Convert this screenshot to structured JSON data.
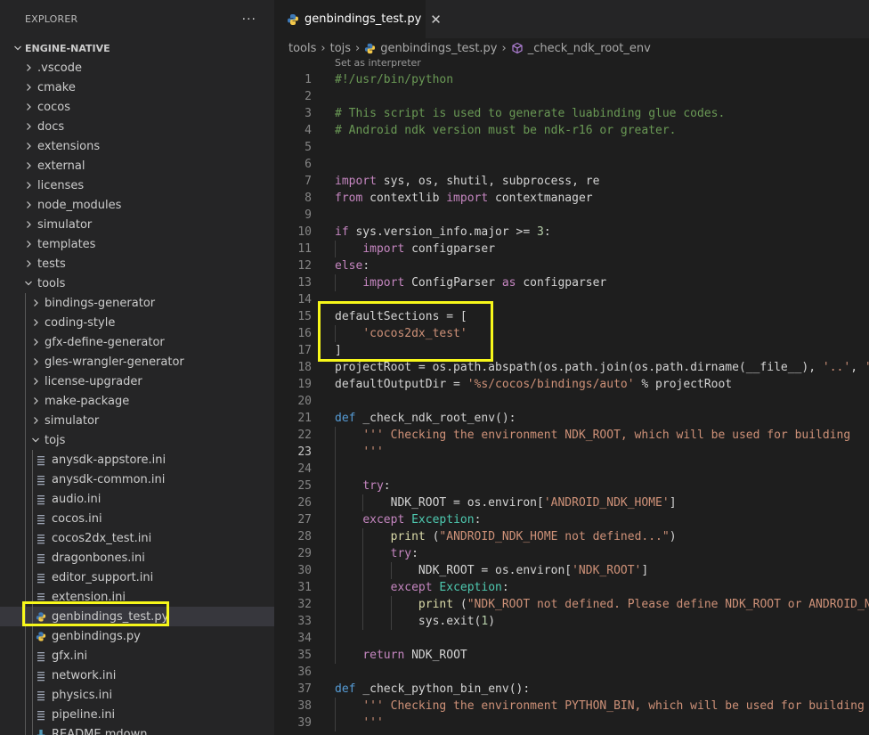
{
  "explorer": {
    "title": "EXPLORER",
    "more": "···",
    "root": "ENGINE-NATIVE",
    "items": [
      {
        "label": ".vscode",
        "type": "folder",
        "depth": 1
      },
      {
        "label": "cmake",
        "type": "folder",
        "depth": 1
      },
      {
        "label": "cocos",
        "type": "folder",
        "depth": 1
      },
      {
        "label": "docs",
        "type": "folder",
        "depth": 1
      },
      {
        "label": "extensions",
        "type": "folder",
        "depth": 1
      },
      {
        "label": "external",
        "type": "folder",
        "depth": 1
      },
      {
        "label": "licenses",
        "type": "folder",
        "depth": 1
      },
      {
        "label": "node_modules",
        "type": "folder",
        "depth": 1
      },
      {
        "label": "simulator",
        "type": "folder",
        "depth": 1
      },
      {
        "label": "templates",
        "type": "folder",
        "depth": 1
      },
      {
        "label": "tests",
        "type": "folder",
        "depth": 1
      },
      {
        "label": "tools",
        "type": "folder-open",
        "depth": 1
      },
      {
        "label": "bindings-generator",
        "type": "folder",
        "depth": 2
      },
      {
        "label": "coding-style",
        "type": "folder",
        "depth": 2
      },
      {
        "label": "gfx-define-generator",
        "type": "folder",
        "depth": 2
      },
      {
        "label": "gles-wrangler-generator",
        "type": "folder",
        "depth": 2
      },
      {
        "label": "license-upgrader",
        "type": "folder",
        "depth": 2
      },
      {
        "label": "make-package",
        "type": "folder",
        "depth": 2
      },
      {
        "label": "simulator",
        "type": "folder",
        "depth": 2
      },
      {
        "label": "tojs",
        "type": "folder-open",
        "depth": 2
      },
      {
        "label": "anysdk-appstore.ini",
        "type": "ini",
        "depth": 3
      },
      {
        "label": "anysdk-common.ini",
        "type": "ini",
        "depth": 3
      },
      {
        "label": "audio.ini",
        "type": "ini",
        "depth": 3
      },
      {
        "label": "cocos.ini",
        "type": "ini",
        "depth": 3
      },
      {
        "label": "cocos2dx_test.ini",
        "type": "ini",
        "depth": 3
      },
      {
        "label": "dragonbones.ini",
        "type": "ini",
        "depth": 3
      },
      {
        "label": "editor_support.ini",
        "type": "ini",
        "depth": 3
      },
      {
        "label": "extension.ini",
        "type": "ini",
        "depth": 3
      },
      {
        "label": "genbindings_test.py",
        "type": "py",
        "depth": 3,
        "selected": true
      },
      {
        "label": "genbindings.py",
        "type": "py",
        "depth": 3
      },
      {
        "label": "gfx.ini",
        "type": "ini",
        "depth": 3
      },
      {
        "label": "network.ini",
        "type": "ini",
        "depth": 3
      },
      {
        "label": "physics.ini",
        "type": "ini",
        "depth": 3
      },
      {
        "label": "pipeline.ini",
        "type": "ini",
        "depth": 3
      },
      {
        "label": "README.mdown",
        "type": "md",
        "depth": 3
      }
    ]
  },
  "tab": {
    "label": "genbindings_test.py",
    "close": "✕"
  },
  "breadcrumb": {
    "parts": [
      "tools",
      "tojs",
      "genbindings_test.py",
      "_check_ndk_root_env"
    ]
  },
  "codelens": "Set as interpreter",
  "active_line": 23,
  "code": [
    {
      "n": 1,
      "tokens": [
        [
          "cm",
          "#!/usr/bin/python"
        ]
      ]
    },
    {
      "n": 2,
      "tokens": []
    },
    {
      "n": 3,
      "tokens": [
        [
          "cm",
          "# This script is used to generate luabinding glue codes."
        ]
      ]
    },
    {
      "n": 4,
      "tokens": [
        [
          "cm",
          "# Android ndk version must be ndk-r16 or greater."
        ]
      ]
    },
    {
      "n": 5,
      "tokens": []
    },
    {
      "n": 6,
      "tokens": []
    },
    {
      "n": 7,
      "tokens": [
        [
          "kw",
          "import"
        ],
        [
          "",
          " sys, os, shutil, subprocess, re"
        ]
      ]
    },
    {
      "n": 8,
      "tokens": [
        [
          "kw",
          "from"
        ],
        [
          "",
          " contextlib "
        ],
        [
          "kw",
          "import"
        ],
        [
          "",
          " contextmanager"
        ]
      ]
    },
    {
      "n": 9,
      "tokens": []
    },
    {
      "n": 10,
      "tokens": [
        [
          "kw",
          "if"
        ],
        [
          "",
          " sys.version_info.major >= "
        ],
        [
          "num",
          "3"
        ],
        [
          "",
          ":"
        ]
      ]
    },
    {
      "n": 11,
      "tokens": [
        [
          "",
          "    "
        ],
        [
          "kw",
          "import"
        ],
        [
          "",
          " configparser"
        ]
      ]
    },
    {
      "n": 12,
      "tokens": [
        [
          "kw",
          "else"
        ],
        [
          "",
          ":"
        ]
      ]
    },
    {
      "n": 13,
      "tokens": [
        [
          "",
          "    "
        ],
        [
          "kw",
          "import"
        ],
        [
          "",
          " ConfigParser "
        ],
        [
          "kw",
          "as"
        ],
        [
          "",
          " configparser"
        ]
      ]
    },
    {
      "n": 14,
      "tokens": []
    },
    {
      "n": 15,
      "tokens": [
        [
          "",
          "defaultSections = ["
        ]
      ]
    },
    {
      "n": 16,
      "tokens": [
        [
          "",
          "    "
        ],
        [
          "str",
          "'cocos2dx_test'"
        ]
      ]
    },
    {
      "n": 17,
      "tokens": [
        [
          "",
          "]"
        ]
      ]
    },
    {
      "n": 18,
      "tokens": [
        [
          "",
          "projectRoot = os.path.abspath(os.path.join(os.path.dirname("
        ],
        [
          "",
          "__file__"
        ],
        [
          "",
          "), "
        ],
        [
          "str",
          "'..'"
        ],
        [
          "",
          ", "
        ],
        [
          "str",
          "'.."
        ]
      ]
    },
    {
      "n": 19,
      "tokens": [
        [
          "",
          "defaultOutputDir = "
        ],
        [
          "str",
          "'%s/cocos/bindings/auto'"
        ],
        [
          "",
          " % projectRoot"
        ]
      ]
    },
    {
      "n": 20,
      "tokens": []
    },
    {
      "n": 21,
      "tokens": [
        [
          "kw2",
          "def"
        ],
        [
          "",
          " "
        ],
        [
          "",
          "_check_ndk_root_env"
        ],
        [
          "",
          "():"
        ]
      ]
    },
    {
      "n": 22,
      "tokens": [
        [
          "",
          "    "
        ],
        [
          "str",
          "''' Checking the environment NDK_ROOT, which will be used for building"
        ]
      ]
    },
    {
      "n": 23,
      "tokens": [
        [
          "",
          "    "
        ],
        [
          "str",
          "'''"
        ]
      ]
    },
    {
      "n": 24,
      "tokens": []
    },
    {
      "n": 25,
      "tokens": [
        [
          "",
          "    "
        ],
        [
          "kw",
          "try"
        ],
        [
          "",
          ":"
        ]
      ]
    },
    {
      "n": 26,
      "tokens": [
        [
          "",
          "        NDK_ROOT = os.environ["
        ],
        [
          "str",
          "'ANDROID_NDK_HOME'"
        ],
        [
          "",
          "]"
        ]
      ]
    },
    {
      "n": 27,
      "tokens": [
        [
          "",
          "    "
        ],
        [
          "kw",
          "except"
        ],
        [
          "",
          " "
        ],
        [
          "cls",
          "Exception"
        ],
        [
          "",
          ":"
        ]
      ]
    },
    {
      "n": 28,
      "tokens": [
        [
          "",
          "        "
        ],
        [
          "fn",
          "print"
        ],
        [
          "",
          " ("
        ],
        [
          "str",
          "\"ANDROID_NDK_HOME not defined...\""
        ],
        [
          "",
          ")"
        ]
      ]
    },
    {
      "n": 29,
      "tokens": [
        [
          "",
          "        "
        ],
        [
          "kw",
          "try"
        ],
        [
          "",
          ":"
        ]
      ]
    },
    {
      "n": 30,
      "tokens": [
        [
          "",
          "            NDK_ROOT = os.environ["
        ],
        [
          "str",
          "'NDK_ROOT'"
        ],
        [
          "",
          "]"
        ]
      ]
    },
    {
      "n": 31,
      "tokens": [
        [
          "",
          "        "
        ],
        [
          "kw",
          "except"
        ],
        [
          "",
          " "
        ],
        [
          "cls",
          "Exception"
        ],
        [
          "",
          ":"
        ]
      ]
    },
    {
      "n": 32,
      "tokens": [
        [
          "",
          "            "
        ],
        [
          "fn",
          "print"
        ],
        [
          "",
          " ("
        ],
        [
          "str",
          "\"NDK_ROOT not defined. Please define NDK_ROOT or ANDROID_ND"
        ]
      ]
    },
    {
      "n": 33,
      "tokens": [
        [
          "",
          "            sys.exit("
        ],
        [
          "num",
          "1"
        ],
        [
          "",
          ")"
        ]
      ]
    },
    {
      "n": 34,
      "tokens": []
    },
    {
      "n": 35,
      "tokens": [
        [
          "",
          "    "
        ],
        [
          "kw",
          "return"
        ],
        [
          "",
          " NDK_ROOT"
        ]
      ]
    },
    {
      "n": 36,
      "tokens": []
    },
    {
      "n": 37,
      "tokens": [
        [
          "kw2",
          "def"
        ],
        [
          "",
          " "
        ],
        [
          "",
          "_check_python_bin_env"
        ],
        [
          "",
          "():"
        ]
      ]
    },
    {
      "n": 38,
      "tokens": [
        [
          "",
          "    "
        ],
        [
          "str",
          "''' Checking the environment PYTHON_BIN, which will be used for building"
        ]
      ]
    },
    {
      "n": 39,
      "tokens": [
        [
          "",
          "    "
        ],
        [
          "str",
          "'''"
        ]
      ]
    }
  ]
}
